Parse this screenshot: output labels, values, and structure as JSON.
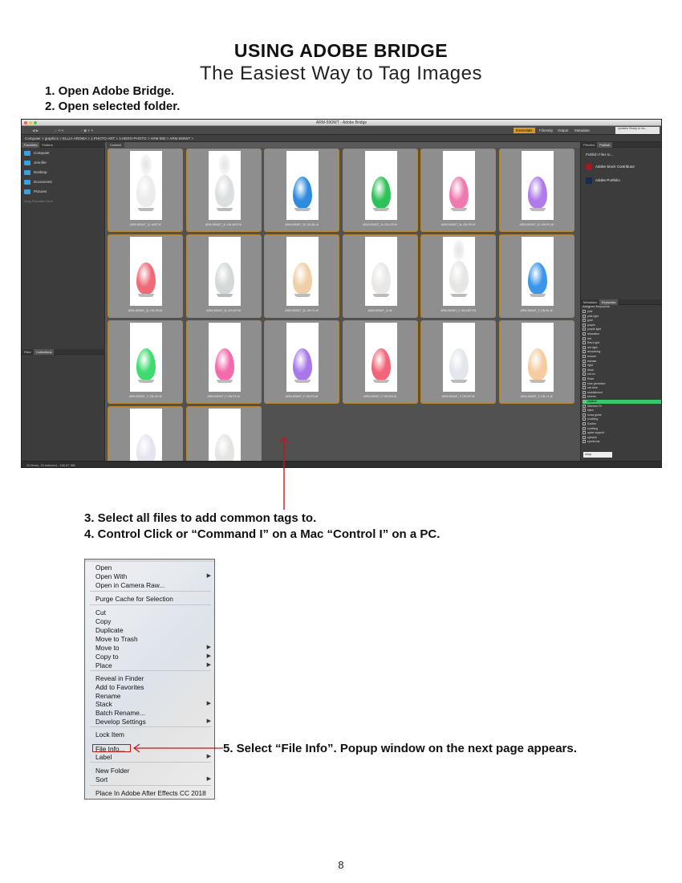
{
  "page": {
    "title": "USING ADOBE BRIDGE",
    "subtitle": "The Easiest Way to Tag Images",
    "steps": {
      "s1": "1. Open Adobe Bridge.",
      "s2": "2. Open selected folder.",
      "s3": "3. Select all files to add common tags to.",
      "s4": "4. Control Click or “Command I” on a Mac “Control I” on a PC.",
      "s5": "5. Select “File Info”. Popup window on the next page appears."
    },
    "page_number": "8"
  },
  "bridge": {
    "window_title": "ARM-590WT - Adobe Bridge",
    "workspaces": [
      "Essentials",
      "Filmstrip",
      "Output",
      "Metadata"
    ],
    "path": "Computer > graphics > ELLIA-AROMA > 1.PHOTO-ART > 2.HERO-PHOTO > ARM-590 > ARM-590WT >",
    "left_tabs": [
      "Favorites",
      "Folders"
    ],
    "favorites": [
      "Computer",
      "Jennifer",
      "Desktop",
      "Documents",
      "Pictures",
      "Drag Favorites Here"
    ],
    "filter_tabs": [
      "Filter",
      "Collections"
    ],
    "content_tab": "Content",
    "right_tabs": [
      "Preview",
      "Publish"
    ],
    "publish_label": "Publish Files to...",
    "publish_items": [
      "Adobe Stock Contributor",
      "Adobe Portfolio"
    ],
    "update_note": "Updates Ready to Ins...",
    "kw_tabs": [
      "Metadata",
      "Keywords"
    ],
    "kw_header": "Assigned Keywords:",
    "keywords": [
      "pink",
      "pink light",
      "gold",
      "purple",
      "purple light",
      "relaxation",
      "red",
      "Red Light",
      "red light",
      "recovering",
      "restore",
      "release",
      "right",
      "ritual",
      "roll on",
      "Rose",
      "rose geranium",
      "rub time",
      "sandalwood",
      "serene",
      "shallow",
      "Siberian Fir",
      "stars",
      "snow globe",
      "soothing",
      "Soothe",
      "soothing",
      "spine support",
      "spinach",
      "sports bar"
    ],
    "selected_keyword_index": 20,
    "search_placeholder": "shop",
    "status": "20 items, 20 selected - 166.87 MB",
    "thumbnails": [
      {
        "label": "ARM-590WT_3L-MIST.tif",
        "color": "#ececec",
        "mist": true
      },
      {
        "label": "ARM-590WT_3L-ON-MIST.tif",
        "color": "#dcdfe0",
        "mist": true
      },
      {
        "label": "ARM-590WT_3L-ON-BL.tif",
        "color": "#2f8be0",
        "mist": false
      },
      {
        "label": "ARM-590WT_3L-ON-GR.tif",
        "color": "#2fc25a",
        "mist": false
      },
      {
        "label": "ARM-590WT_3L-ON-PK.tif",
        "color": "#f07ab0",
        "mist": false
      },
      {
        "label": "ARM-590WT_3L-ON-PU.tif",
        "color": "#b07ae8",
        "mist": false
      },
      {
        "label": "ARM-590WT_3L-ON-RD.tif",
        "color": "#f06a78",
        "mist": false
      },
      {
        "label": "ARM-590WT_3L-ON-WT.tif",
        "color": "#d4d8d8",
        "mist": false
      },
      {
        "label": "ARM-590WT_3L-ON-YL.tif",
        "color": "#f0cfa6",
        "mist": false
      },
      {
        "label": "ARM-590WT_3L.tif",
        "color": "#e9e8e6",
        "mist": false
      },
      {
        "label": "ARM-590WT_F-ON-MIST.tif",
        "color": "#e6e6e4",
        "mist": true
      },
      {
        "label": "ARM-590WT_F-ON-BL.tif",
        "color": "#3b95ea",
        "mist": false
      },
      {
        "label": "ARM-590WT_F-ON-GR.tif",
        "color": "#3fdb70",
        "mist": false
      },
      {
        "label": "ARM-590WT_F-ON-PK.tif",
        "color": "#f46aac",
        "mist": false
      },
      {
        "label": "ARM-590WT_F-ON-PU.tif",
        "color": "#a878ea",
        "mist": false
      },
      {
        "label": "ARM-590WT_F-ON-RD.tif",
        "color": "#f26578",
        "mist": false
      },
      {
        "label": "ARM-590WT_F-ON-WT.tif",
        "color": "#e3e6ea",
        "mist": false
      },
      {
        "label": "ARM-590WT_F-ON-YL.tif",
        "color": "#f5cca0",
        "mist": false
      },
      {
        "label": "",
        "color": "#e6e4ee",
        "mist": false
      },
      {
        "label": "",
        "color": "#e4e4e2",
        "mist": false
      }
    ]
  },
  "menu": {
    "items": [
      {
        "label": "Open",
        "sub": false
      },
      {
        "label": "Open With",
        "sub": true
      },
      {
        "label": "Open in Camera Raw...",
        "sub": false
      },
      {
        "label": "Purge Cache for Selection",
        "sub": false
      },
      {
        "label": "Cut",
        "sub": false
      },
      {
        "label": "Copy",
        "sub": false
      },
      {
        "label": "Duplicate",
        "sub": false
      },
      {
        "label": "Move to Trash",
        "sub": false
      },
      {
        "label": "Move to",
        "sub": true
      },
      {
        "label": "Copy to",
        "sub": true
      },
      {
        "label": "Place",
        "sub": true
      },
      {
        "label": "Reveal in Finder",
        "sub": false
      },
      {
        "label": "Add to Favorites",
        "sub": false
      },
      {
        "label": "Rename",
        "sub": false
      },
      {
        "label": "Stack",
        "sub": true
      },
      {
        "label": "Batch Rename...",
        "sub": false
      },
      {
        "label": "Develop Settings",
        "sub": true
      },
      {
        "label": "Lock Item",
        "sub": false
      },
      {
        "label": "File Info...",
        "sub": false
      },
      {
        "label": "Label",
        "sub": true
      },
      {
        "label": "New Folder",
        "sub": false
      },
      {
        "label": "Sort",
        "sub": true
      },
      {
        "label": "Place In Adobe After Effects CC 2018",
        "sub": false
      }
    ],
    "submenu_glyph": "▶"
  },
  "colors": {
    "accent": "#d69a2d",
    "highlight": "#c21818",
    "keyword_selected": "#39c96a"
  }
}
